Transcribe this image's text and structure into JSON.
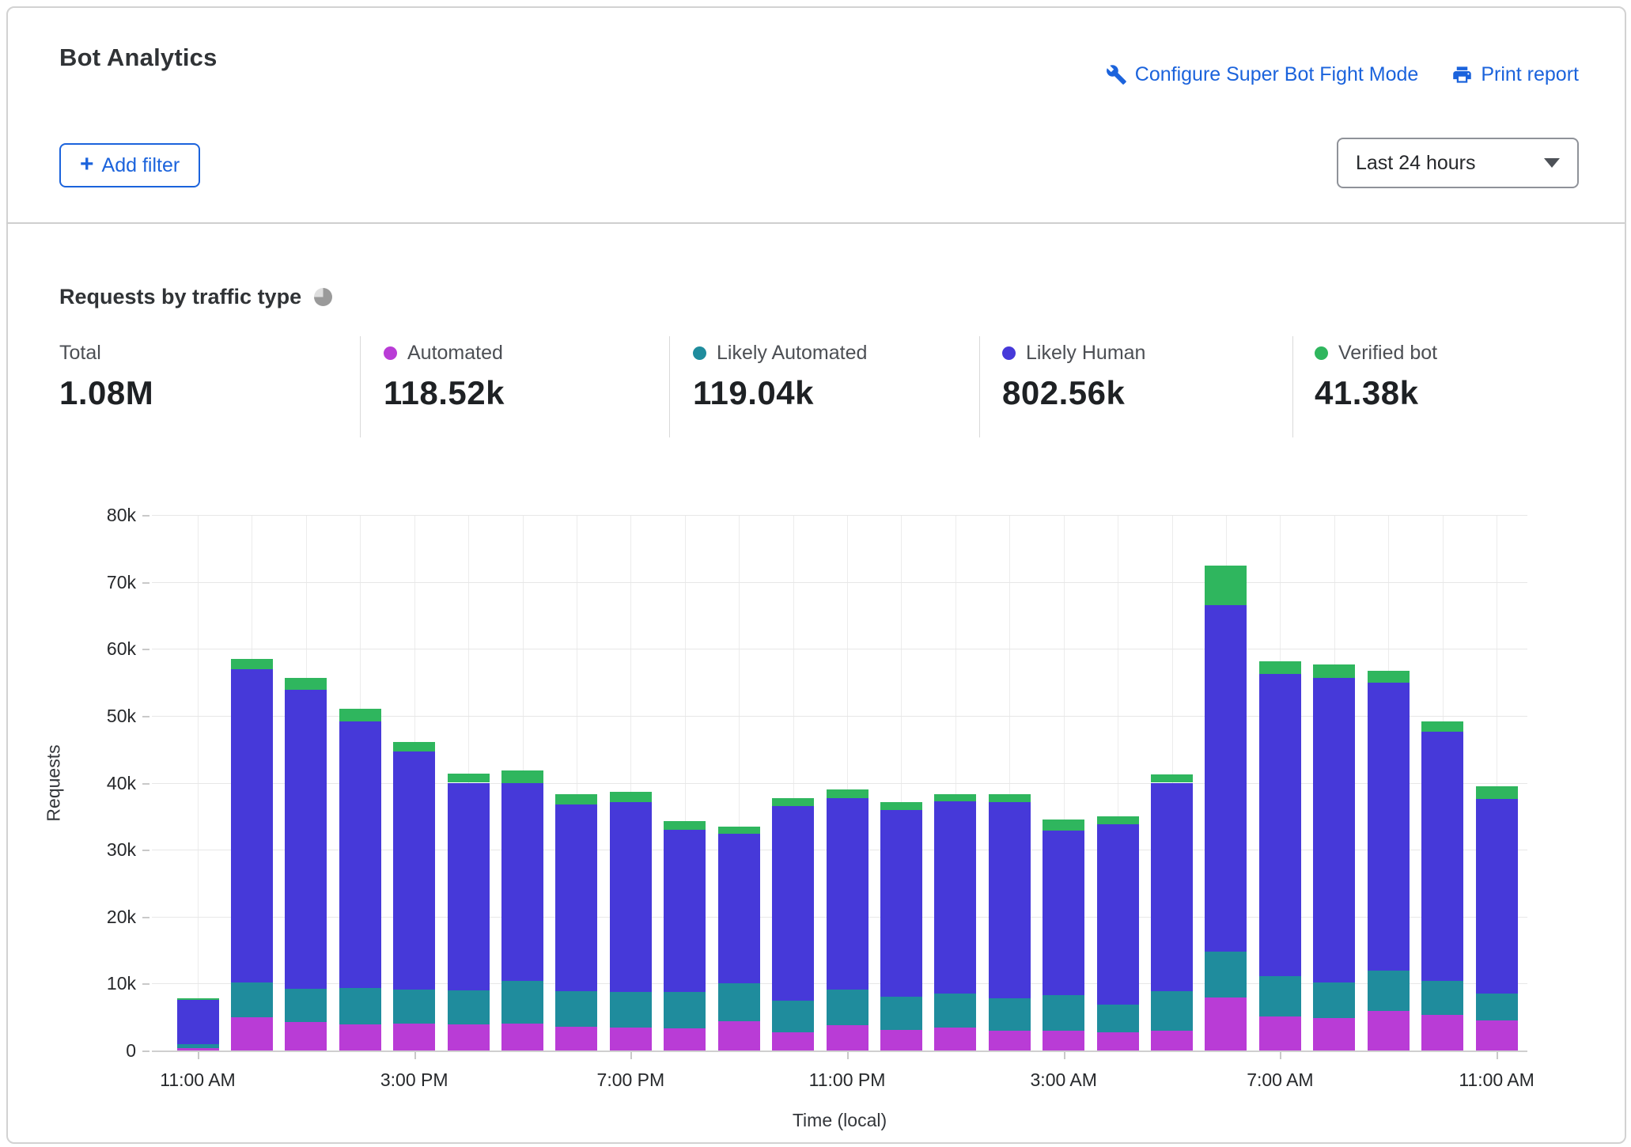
{
  "header": {
    "title": "Bot Analytics",
    "configure_link": "Configure Super Bot Fight Mode",
    "print_link": "Print report",
    "add_filter_label": "Add filter",
    "add_filter_plus": "+",
    "time_range": "Last 24 hours"
  },
  "section": {
    "title": "Requests by traffic type"
  },
  "stats": [
    {
      "label": "Total",
      "value": "1.08M"
    },
    {
      "label": "Automated",
      "value": "118.52k",
      "color": "#b93cd6"
    },
    {
      "label": "Likely Automated",
      "value": "119.04k",
      "color": "#1f8c9d"
    },
    {
      "label": "Likely Human",
      "value": "802.56k",
      "color": "#4639d9"
    },
    {
      "label": "Verified bot",
      "value": "41.38k",
      "color": "#2fb65e"
    }
  ],
  "chart_data": {
    "type": "bar",
    "stacked": true,
    "title": "Requests by traffic type",
    "xlabel": "Time (local)",
    "ylabel": "Requests",
    "ylim": [
      0,
      80000
    ],
    "grid": true,
    "legend_position": "top-stats-row",
    "categories": [
      "11:00 AM",
      "12:00 PM",
      "1:00 PM",
      "2:00 PM",
      "3:00 PM",
      "4:00 PM",
      "5:00 PM",
      "6:00 PM",
      "7:00 PM",
      "8:00 PM",
      "9:00 PM",
      "10:00 PM",
      "11:00 PM",
      "12:00 AM",
      "1:00 AM",
      "2:00 AM",
      "3:00 AM",
      "4:00 AM",
      "5:00 AM",
      "6:00 AM",
      "7:00 AM",
      "8:00 AM",
      "9:00 AM",
      "10:00 AM",
      "11:00 AM"
    ],
    "series": [
      {
        "name": "Automated",
        "color": "#b93cd6",
        "values": [
          400,
          5000,
          4300,
          3900,
          4000,
          3900,
          4000,
          3500,
          3400,
          3300,
          4400,
          2700,
          3800,
          3100,
          3400,
          2900,
          2900,
          2700,
          2900,
          7900,
          5100,
          4800,
          5900,
          5300,
          4500
        ]
      },
      {
        "name": "Likely Automated",
        "color": "#1f8c9d",
        "values": [
          500,
          5200,
          4900,
          5400,
          5100,
          5100,
          6400,
          5400,
          5400,
          5400,
          5700,
          4700,
          5300,
          4900,
          5100,
          4900,
          5400,
          4100,
          6000,
          6900,
          6000,
          5400,
          6000,
          5100,
          4000
        ]
      },
      {
        "name": "Likely Human",
        "color": "#4639d9",
        "values": [
          6700,
          46800,
          44700,
          39800,
          35600,
          31000,
          29500,
          27800,
          28300,
          24300,
          22300,
          29100,
          28600,
          27900,
          28700,
          29300,
          24500,
          27000,
          31100,
          51700,
          45100,
          45400,
          43100,
          37200,
          29100
        ]
      },
      {
        "name": "Verified bot",
        "color": "#2fb65e",
        "values": [
          200,
          1500,
          1700,
          1900,
          1400,
          1400,
          1900,
          1600,
          1500,
          1300,
          1100,
          1200,
          1300,
          1200,
          1100,
          1200,
          1700,
          1200,
          1200,
          5900,
          1900,
          2100,
          1700,
          1500,
          1900
        ]
      }
    ],
    "yticks": [
      {
        "v": 0,
        "label": "0"
      },
      {
        "v": 10000,
        "label": "10k"
      },
      {
        "v": 20000,
        "label": "20k"
      },
      {
        "v": 30000,
        "label": "30k"
      },
      {
        "v": 40000,
        "label": "40k"
      },
      {
        "v": 50000,
        "label": "50k"
      },
      {
        "v": 60000,
        "label": "60k"
      },
      {
        "v": 70000,
        "label": "70k"
      },
      {
        "v": 80000,
        "label": "80k"
      }
    ],
    "xticks": [
      {
        "i": 0,
        "label": "11:00 AM"
      },
      {
        "i": 4,
        "label": "3:00 PM"
      },
      {
        "i": 8,
        "label": "7:00 PM"
      },
      {
        "i": 12,
        "label": "11:00 PM"
      },
      {
        "i": 16,
        "label": "3:00 AM"
      },
      {
        "i": 20,
        "label": "7:00 AM"
      },
      {
        "i": 24,
        "label": "11:00 AM"
      }
    ]
  }
}
